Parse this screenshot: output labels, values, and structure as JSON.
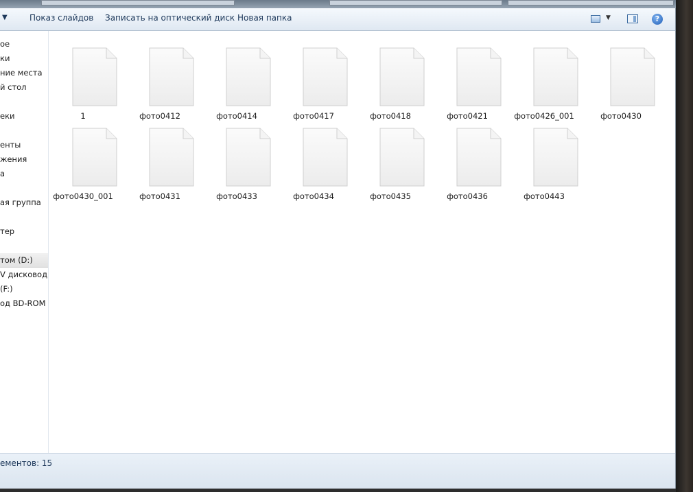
{
  "toolbar": {
    "slideshow_label": "Показ слайдов",
    "burn_label": "Записать на оптический диск",
    "new_folder_label": "Новая папка"
  },
  "nav": {
    "items": [
      {
        "label": "ое"
      },
      {
        "label": "ки"
      },
      {
        "label": "ние места"
      },
      {
        "label": "й стол"
      },
      {
        "label": "еки"
      },
      {
        "label": "енты"
      },
      {
        "label": "жения"
      },
      {
        "label": "а"
      },
      {
        "label": "ая группа"
      },
      {
        "label": "тер"
      },
      {
        "label": "том (D:)"
      },
      {
        "label": "V дисковод (E"
      },
      {
        "label": "(F:)"
      },
      {
        "label": "од BD-ROM ("
      }
    ]
  },
  "files": [
    {
      "name": "1"
    },
    {
      "name": "фото0412"
    },
    {
      "name": "фото0414"
    },
    {
      "name": "фото0417"
    },
    {
      "name": "фото0418"
    },
    {
      "name": "фото0421"
    },
    {
      "name": "фото0426_001"
    },
    {
      "name": "фото0430"
    },
    {
      "name": "фото0430_001"
    },
    {
      "name": "фото0431"
    },
    {
      "name": "фото0433"
    },
    {
      "name": "фото0434"
    },
    {
      "name": "фото0435"
    },
    {
      "name": "фото0436"
    },
    {
      "name": "фото0443"
    }
  ],
  "status": {
    "text": "ементов: 15"
  },
  "colors": {
    "toolbar_text": "#1e395b",
    "accent": "#3a6aa0"
  }
}
